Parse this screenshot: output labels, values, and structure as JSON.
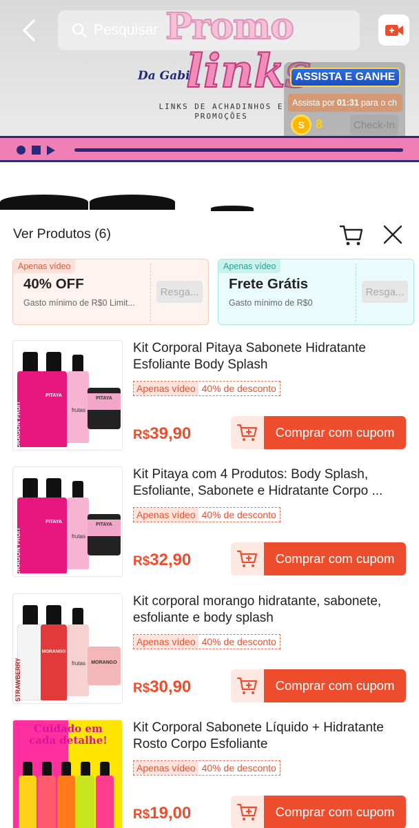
{
  "search": {
    "placeholder": "Pesquisar"
  },
  "banner": {
    "logo_word1": "Promo",
    "logo_word2": "links",
    "logo_sub": "Da Gabi",
    "logo_tagline": "LINKS DE ACHADINHOS E PROMOÇÕES"
  },
  "watch": {
    "title": "ASSISTA E GANHE",
    "timer_prefix": "Assista por",
    "timer_value": "01:31",
    "timer_suffix": "para o ch",
    "coin_symbol": "S",
    "coins": "8",
    "checkin_label": "Check-In"
  },
  "sheet": {
    "title": "Ver Produtos (6)"
  },
  "coupons": [
    {
      "tag": "Apenas vídeo",
      "title": "40% OFF",
      "subtitle": "Gasto mínimo de R$0 Limit...",
      "claim": "Resga..."
    },
    {
      "tag": "Apenas vídeo",
      "title": "Frete Grátis",
      "subtitle": "Gasto mínimo de R$0",
      "claim": "Resga..."
    }
  ],
  "products": [
    {
      "name": "Kit Corporal Pitaya Sabonete Hidratante Esfoliante Body Splash",
      "badge": "Apenas vídeo",
      "discount": "40% de desconto",
      "currency": "R$",
      "price": "39,90",
      "button": "Comprar com cupom"
    },
    {
      "name": "Kit Pitaya com 4 Produtos: Body Splash, Esfoliante, Sabonete e Hidratante Corpo ...",
      "badge": "Apenas vídeo",
      "discount": "40% de desconto",
      "currency": "R$",
      "price": "32,90",
      "button": "Comprar com cupom"
    },
    {
      "name": "Kit corporal morango hidratante, sabonete, esfoliante e body splash",
      "badge": "Apenas vídeo",
      "discount": "40% de desconto",
      "currency": "R$",
      "price": "30,90",
      "button": "Comprar com cupom"
    },
    {
      "name": "Kit Corporal Sabonete Líquido + Hidratante Rosto Corpo Esfoliante",
      "badge": "Apenas vídeo",
      "discount": "40% de desconto",
      "currency": "R$",
      "price": "19,00",
      "button": "Comprar com cupom"
    }
  ],
  "product_art": [
    {
      "label": "DRAGON FRUIT",
      "label2": "PITAYA",
      "label3": "frutas",
      "bottle_color": "#e8177f",
      "jar_label": "PITAYA"
    },
    {
      "label": "DRAGON FRUIT",
      "label2": "PITAYA",
      "label3": "frutas",
      "bottle_color": "#e8177f",
      "jar_label": "PITAYA"
    },
    {
      "label": "STRAWBERRY",
      "label2": "MORANGO",
      "label3": "frutas",
      "bottle_color": "#e23a3a",
      "jar_label": "MORANGO"
    },
    {
      "label": "Cuidado em cada detalhe!",
      "label2": "",
      "label3": "",
      "bottle_color": "#ff7a18",
      "jar_label": ""
    }
  ],
  "colors": {
    "accent": "#ee4d2d",
    "pink": "#f07fb6",
    "navy": "#2a2a78"
  }
}
